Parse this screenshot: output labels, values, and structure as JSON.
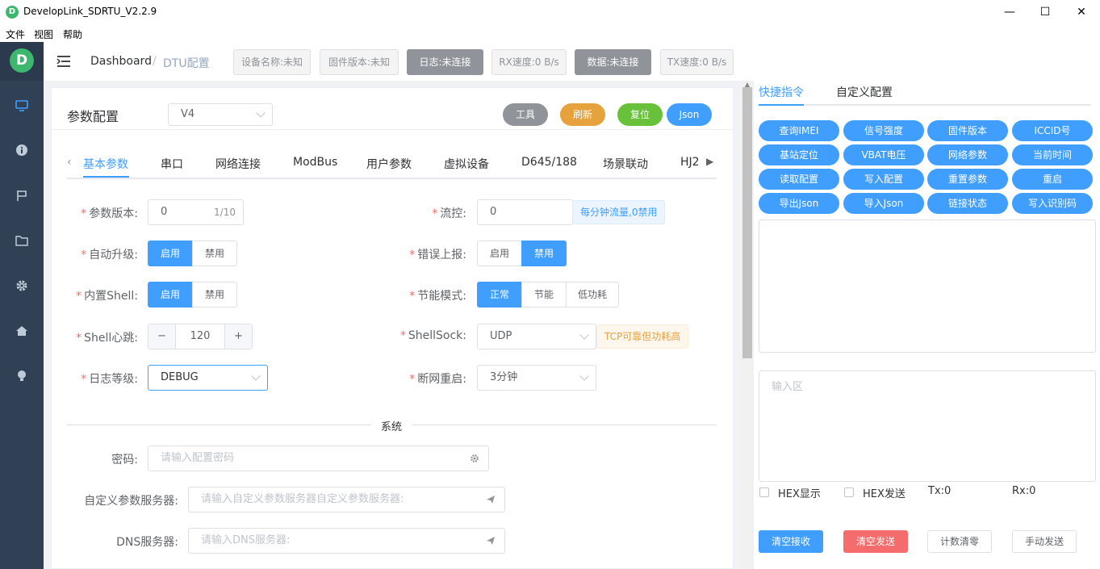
{
  "window": {
    "title": "DevelopLink_SDRTU_V2.2.9",
    "logo_letter": "D",
    "minimize": "—",
    "maximize": "☐",
    "close": "✕"
  },
  "menu": [
    "文件",
    "视图",
    "帮助"
  ],
  "sidebar": {
    "icons": [
      "monitor-icon",
      "info-icon",
      "flag-icon",
      "folder-icon",
      "gear-icon",
      "home-icon",
      "bulb-icon"
    ]
  },
  "topbar": {
    "breadcrumb": [
      "Dashboard",
      "DTU配置"
    ],
    "separator": "/",
    "status": [
      "设备名称:未知",
      "固件版本:未知",
      "日志:未连接",
      "RX速度:0 B/s",
      "数据:未连接",
      "TX速度:0 B/s"
    ]
  },
  "config": {
    "title": "参数配置",
    "version_select": "V4",
    "actions": [
      "工具",
      "刷新",
      "复位",
      "Json"
    ],
    "action_colors": [
      "#909399",
      "#e6a23c",
      "#67c23a",
      "#409eff"
    ],
    "tabs": [
      "基本参数",
      "串口",
      "网络连接",
      "ModBus",
      "用户参数",
      "虚拟设备",
      "D645/188",
      "场景联动",
      "HJ2"
    ],
    "fields": {
      "param_version": {
        "label": "参数版本:",
        "value": "0",
        "count": "1/10"
      },
      "flow_control": {
        "label": "流控:",
        "value": "0",
        "hint": "每分钟流量,0禁用"
      },
      "auto_upgrade": {
        "label": "自动升级:",
        "options": [
          "启用",
          "禁用"
        ]
      },
      "error_report": {
        "label": "错误上报:",
        "options": [
          "启用",
          "禁用"
        ]
      },
      "builtin_shell": {
        "label": "内置Shell:",
        "options": [
          "启用",
          "禁用"
        ]
      },
      "power_mode": {
        "label": "节能模式:",
        "options": [
          "正常",
          "节能",
          "低功耗"
        ]
      },
      "shell_heartbeat": {
        "label": "Shell心跳:",
        "value": "120",
        "minus": "−",
        "plus": "+"
      },
      "shell_sock": {
        "label": "ShellSock:",
        "value": "UDP",
        "hint": "TCP可靠但功耗高"
      },
      "log_level": {
        "label": "日志等级:",
        "value": "DEBUG"
      },
      "offline_restart": {
        "label": "断网重启:",
        "value": "3分钟"
      }
    },
    "section_system": "系统",
    "password": {
      "label": "密码:",
      "placeholder": "请输入配置密码"
    },
    "custom_server": {
      "label": "自定义参数服务器:",
      "placeholder": "请输入自定义参数服务器自定义参数服务器:"
    },
    "dns_server": {
      "label": "DNS服务器:",
      "placeholder": "请输入DNS服务器:"
    }
  },
  "right_panel": {
    "tabs": [
      "快捷指令",
      "自定义配置"
    ],
    "quick_buttons": [
      "查询IMEI",
      "信号强度",
      "固件版本",
      "ICCID号",
      "基站定位",
      "VBAT电压",
      "网络参数",
      "当前时间",
      "读取配置",
      "写入配置",
      "重置参数",
      "重启",
      "导出Json",
      "导入Json",
      "链接状态",
      "写入识别码"
    ],
    "input_placeholder": "输入区",
    "hex_display": "HEX显示",
    "hex_send": "HEX发送",
    "tx": "Tx:0",
    "rx": "Rx:0",
    "bottom_buttons": [
      "清空接收",
      "清空发送",
      "计数清零",
      "手动发送"
    ]
  },
  "colors": {
    "primary": "#409eff",
    "sidebar": "#304156",
    "danger": "#f56c6c",
    "warning": "#e6a23c",
    "success": "#67c23a"
  }
}
